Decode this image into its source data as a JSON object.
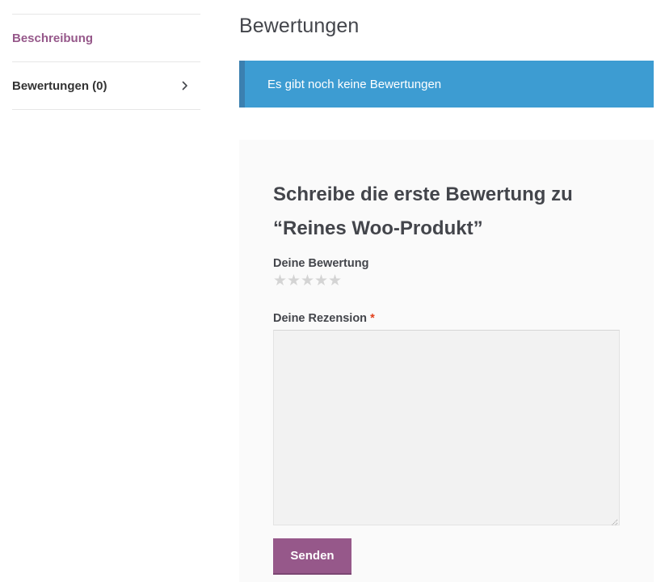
{
  "tabs": {
    "items": [
      {
        "label": "Beschreibung",
        "active": true
      },
      {
        "label": "Bewertungen (0)",
        "active": false,
        "icon": "chevron-right-icon"
      }
    ]
  },
  "reviews": {
    "heading": "Bewertungen",
    "notice": "Es gibt noch keine Bewertungen",
    "form": {
      "title": "Schreibe die erste Bewertung zu “Reines Woo-Produkt”",
      "rating_label": "Deine Bewertung",
      "rating_value": 0,
      "rating_max": 5,
      "review_label": "Deine Rezension",
      "required_marker": "*",
      "review_value": "",
      "submit_label": "Senden"
    }
  },
  "colors": {
    "accent": "#96588a",
    "notice_bg": "#3d9cd2",
    "notice_border": "#3b80b0",
    "required": "#e2401c",
    "star_empty": "#d4d4d4"
  }
}
